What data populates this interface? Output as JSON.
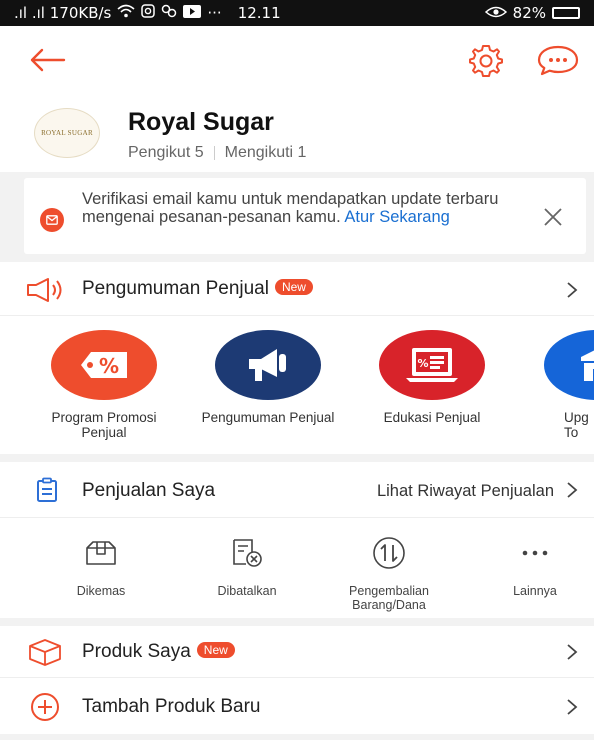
{
  "status_bar": {
    "left": ".ıl .ıl 170KB/s",
    "time": "12.11",
    "battery": "82%"
  },
  "profile": {
    "avatar_text": "ROYAL SUGAR",
    "name": "Royal Sugar",
    "followers": "Pengikut 5",
    "following": "Mengikuti 1"
  },
  "banner": {
    "text": "Verifikasi email kamu untuk mendapatkan update terbaru mengenai pesanan-pesanan kamu. ",
    "link": "Atur Sekarang"
  },
  "announcement": {
    "label": "Pengumuman Penjual",
    "badge": "New"
  },
  "shortcuts": [
    {
      "label": "Program Promosi Penjual",
      "color": "#ee4d2d"
    },
    {
      "label": "Pengumuman Penjual",
      "color": "#1d3a74"
    },
    {
      "label": "Edukasi Penjual",
      "color": "#d8232a"
    },
    {
      "label": "Upg\nTo",
      "color": "#1565d8"
    }
  ],
  "sales": {
    "label": "Penjualan Saya",
    "history": "Lihat Riwayat Penjualan"
  },
  "orders": [
    {
      "label": "Dikemas"
    },
    {
      "label": "Dibatalkan"
    },
    {
      "label": "Pengembalian Barang/Dana"
    },
    {
      "label": "Lainnya"
    }
  ],
  "products": {
    "label": "Produk Saya",
    "badge": "New"
  },
  "add_product": {
    "label": "Tambah Produk Baru"
  },
  "colors": {
    "accent": "#ee4d2d",
    "link": "#1a6fd1",
    "icon_blue": "#2d6fd6"
  }
}
